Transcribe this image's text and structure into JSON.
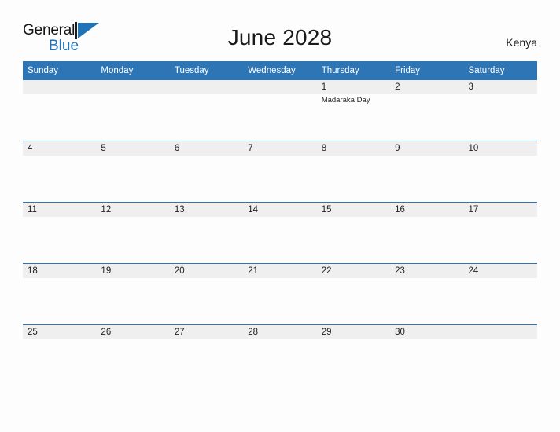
{
  "brand": {
    "name_part1": "General",
    "name_part2": "Blue",
    "mark": "triangle-logo",
    "color_blue": "#2173b7",
    "color_dark": "#141414"
  },
  "header": {
    "title": "June 2028",
    "country": "Kenya"
  },
  "theme": {
    "header_blue": "#2e75b6",
    "date_band_gray": "#efefef",
    "page_background": "#fdfdfd",
    "text_dark": "#222222"
  },
  "calendar": {
    "month": "June",
    "year": "2028",
    "weekday_headers": [
      "Sunday",
      "Monday",
      "Tuesday",
      "Wednesday",
      "Thursday",
      "Friday",
      "Saturday"
    ],
    "weeks": [
      [
        {
          "day": "",
          "events": []
        },
        {
          "day": "",
          "events": []
        },
        {
          "day": "",
          "events": []
        },
        {
          "day": "",
          "events": []
        },
        {
          "day": "1",
          "events": [
            "Madaraka Day"
          ]
        },
        {
          "day": "2",
          "events": []
        },
        {
          "day": "3",
          "events": []
        }
      ],
      [
        {
          "day": "4",
          "events": []
        },
        {
          "day": "5",
          "events": []
        },
        {
          "day": "6",
          "events": []
        },
        {
          "day": "7",
          "events": []
        },
        {
          "day": "8",
          "events": []
        },
        {
          "day": "9",
          "events": []
        },
        {
          "day": "10",
          "events": []
        }
      ],
      [
        {
          "day": "11",
          "events": []
        },
        {
          "day": "12",
          "events": []
        },
        {
          "day": "13",
          "events": []
        },
        {
          "day": "14",
          "events": []
        },
        {
          "day": "15",
          "events": []
        },
        {
          "day": "16",
          "events": []
        },
        {
          "day": "17",
          "events": []
        }
      ],
      [
        {
          "day": "18",
          "events": []
        },
        {
          "day": "19",
          "events": []
        },
        {
          "day": "20",
          "events": []
        },
        {
          "day": "21",
          "events": []
        },
        {
          "day": "22",
          "events": []
        },
        {
          "day": "23",
          "events": []
        },
        {
          "day": "24",
          "events": []
        }
      ],
      [
        {
          "day": "25",
          "events": []
        },
        {
          "day": "26",
          "events": []
        },
        {
          "day": "27",
          "events": []
        },
        {
          "day": "28",
          "events": []
        },
        {
          "day": "29",
          "events": []
        },
        {
          "day": "30",
          "events": []
        },
        {
          "day": "",
          "events": []
        }
      ]
    ]
  }
}
